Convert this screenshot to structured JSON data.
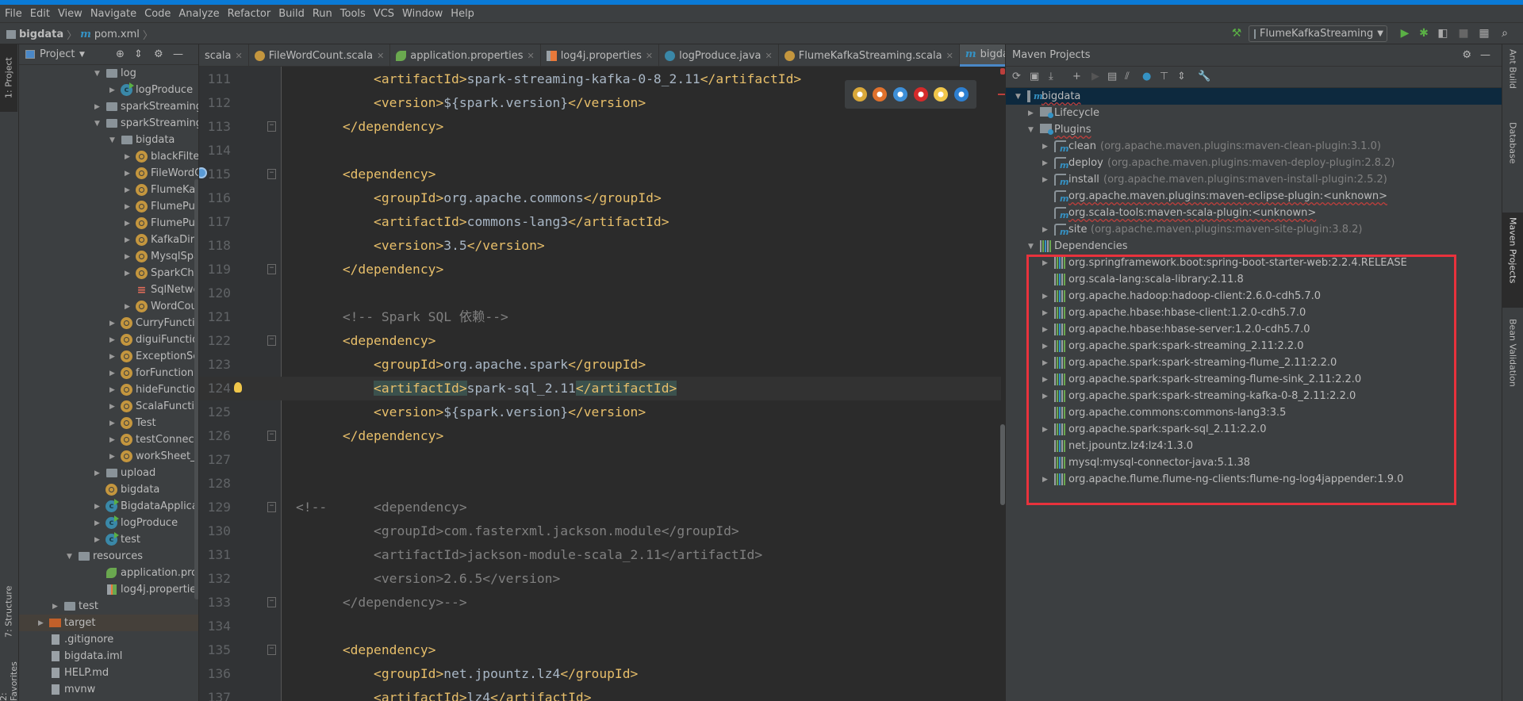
{
  "menu": [
    "File",
    "Edit",
    "View",
    "Navigate",
    "Code",
    "Analyze",
    "Refactor",
    "Build",
    "Run",
    "Tools",
    "VCS",
    "Window",
    "Help"
  ],
  "breadcrumb": {
    "project": "bigdata",
    "file": "pom.xml",
    "file_icon": "m"
  },
  "run_config": "FlumeKafkaStreaming",
  "left_strip": {
    "project": "1: Project",
    "structure": "7: Structure",
    "favorites": "2: Favorites"
  },
  "project_panel": {
    "title": "Project",
    "tree": [
      {
        "label": "log",
        "level": 3,
        "icon": "folder",
        "arrow": "open"
      },
      {
        "label": "logProduce",
        "level": 4,
        "icon": "cls",
        "arrow": "closed"
      },
      {
        "label": "sparkStreaming",
        "level": 3,
        "icon": "folder",
        "arrow": "closed"
      },
      {
        "label": "sparkStreamingSc",
        "level": 3,
        "icon": "folder",
        "arrow": "open"
      },
      {
        "label": "bigdata",
        "level": 4,
        "icon": "folder",
        "arrow": "open"
      },
      {
        "label": "blackFilter",
        "level": 5,
        "icon": "obj",
        "arrow": "closed"
      },
      {
        "label": "FileWordCo",
        "level": 5,
        "icon": "obj",
        "arrow": "closed"
      },
      {
        "label": "FlumeKafka",
        "level": 5,
        "icon": "obj",
        "arrow": "closed"
      },
      {
        "label": "FlumePullW",
        "level": 5,
        "icon": "obj",
        "arrow": "closed"
      },
      {
        "label": "FlumePushV",
        "level": 5,
        "icon": "obj",
        "arrow": "closed"
      },
      {
        "label": "KafkaDirect",
        "level": 5,
        "icon": "obj",
        "arrow": "closed"
      },
      {
        "label": "MysqlSpark",
        "level": 5,
        "icon": "obj",
        "arrow": "closed"
      },
      {
        "label": "SparkCheck",
        "level": 5,
        "icon": "obj",
        "arrow": "closed"
      },
      {
        "label": "SqlNetwork",
        "level": 5,
        "icon": "sql",
        "arrow": "none"
      },
      {
        "label": "WordCount",
        "level": 5,
        "icon": "obj",
        "arrow": "closed"
      },
      {
        "label": "CurryFunction",
        "level": 4,
        "icon": "obj",
        "arrow": "closed"
      },
      {
        "label": "diguiFunction",
        "level": 4,
        "icon": "obj",
        "arrow": "closed"
      },
      {
        "label": "ExceptionScala",
        "level": 4,
        "icon": "obj",
        "arrow": "closed"
      },
      {
        "label": "forFunction",
        "level": 4,
        "icon": "obj",
        "arrow": "closed"
      },
      {
        "label": "hideFunction",
        "level": 4,
        "icon": "obj",
        "arrow": "closed"
      },
      {
        "label": "ScalaFunction",
        "level": 4,
        "icon": "obj",
        "arrow": "closed"
      },
      {
        "label": "Test",
        "level": 4,
        "icon": "obj",
        "arrow": "closed"
      },
      {
        "label": "testConnectSql",
        "level": 4,
        "icon": "obj",
        "arrow": "closed"
      },
      {
        "label": "workSheet_che",
        "level": 4,
        "icon": "obj",
        "arrow": "closed"
      },
      {
        "label": "upload",
        "level": 3,
        "icon": "folder",
        "arrow": "closed"
      },
      {
        "label": "bigdata",
        "level": 3,
        "icon": "obj",
        "arrow": "none"
      },
      {
        "label": "BigdataApplicatio",
        "level": 3,
        "icon": "cls",
        "arrow": "closed"
      },
      {
        "label": "logProduce",
        "level": 3,
        "icon": "cls",
        "arrow": "closed"
      },
      {
        "label": "test",
        "level": 3,
        "icon": "cls",
        "arrow": "closed"
      },
      {
        "label": "resources",
        "level": 2,
        "icon": "folder",
        "arrow": "open"
      },
      {
        "label": "application.propertie",
        "level": 3,
        "icon": "spring",
        "arrow": "none"
      },
      {
        "label": "log4j.properties",
        "level": 3,
        "icon": "log4j",
        "arrow": "none"
      },
      {
        "label": "test",
        "level": 1,
        "icon": "folder",
        "arrow": "closed"
      },
      {
        "label": "target",
        "level": 0,
        "icon": "tfolder",
        "arrow": "closed",
        "highlight": true
      },
      {
        "label": ".gitignore",
        "level": 0,
        "icon": "file",
        "arrow": "none"
      },
      {
        "label": "bigdata.iml",
        "level": 0,
        "icon": "file",
        "arrow": "none"
      },
      {
        "label": "HELP.md",
        "level": 0,
        "icon": "file",
        "arrow": "none"
      },
      {
        "label": "mvnw",
        "level": 0,
        "icon": "file",
        "arrow": "none"
      }
    ]
  },
  "tabs": [
    {
      "label": "scala",
      "icon": "none"
    },
    {
      "label": "FileWordCount.scala",
      "icon": "scala"
    },
    {
      "label": "application.properties",
      "icon": "spring"
    },
    {
      "label": "log4j.properties",
      "icon": "log4j"
    },
    {
      "label": "logProduce.java",
      "icon": "java"
    },
    {
      "label": "FlumeKafkaStreaming.scala",
      "icon": "scala"
    },
    {
      "label": "bigdata",
      "icon": "maven",
      "active": true
    }
  ],
  "tab_overflow": "▾≡4",
  "editor": {
    "current_line": 124,
    "lines": [
      {
        "n": "111",
        "indent": 10,
        "seg": [
          [
            "tag",
            "<artifactId>"
          ],
          [
            "txt",
            "spark-streaming-kafka-0-8_2.11"
          ],
          [
            "tag",
            "</artifactId>"
          ]
        ]
      },
      {
        "n": "112",
        "indent": 10,
        "seg": [
          [
            "tag",
            "<version>"
          ],
          [
            "txt",
            "${spark.version}"
          ],
          [
            "tag",
            "</version>"
          ]
        ]
      },
      {
        "n": "113",
        "indent": 6,
        "fold": "end",
        "seg": [
          [
            "tag",
            "</dependency>"
          ]
        ]
      },
      {
        "n": "114",
        "indent": 0,
        "seg": []
      },
      {
        "n": "115",
        "indent": 6,
        "fold": "start",
        "mark": "override",
        "seg": [
          [
            "tag",
            "<dependency>"
          ]
        ]
      },
      {
        "n": "116",
        "indent": 10,
        "seg": [
          [
            "tag",
            "<groupId>"
          ],
          [
            "txt",
            "org.apache.commons"
          ],
          [
            "tag",
            "</groupId>"
          ]
        ]
      },
      {
        "n": "117",
        "indent": 10,
        "seg": [
          [
            "tag",
            "<artifactId>"
          ],
          [
            "txt",
            "commons-lang3"
          ],
          [
            "tag",
            "</artifactId>"
          ]
        ]
      },
      {
        "n": "118",
        "indent": 10,
        "seg": [
          [
            "tag",
            "<version>"
          ],
          [
            "txt",
            "3.5"
          ],
          [
            "tag",
            "</version>"
          ]
        ]
      },
      {
        "n": "119",
        "indent": 6,
        "fold": "end",
        "seg": [
          [
            "tag",
            "</dependency>"
          ]
        ]
      },
      {
        "n": "120",
        "indent": 0,
        "seg": []
      },
      {
        "n": "121",
        "indent": 6,
        "seg": [
          [
            "cm",
            "<!-- Spark SQL 依赖-->"
          ]
        ]
      },
      {
        "n": "122",
        "indent": 6,
        "fold": "start",
        "seg": [
          [
            "tag",
            "<dependency>"
          ]
        ]
      },
      {
        "n": "123",
        "indent": 10,
        "seg": [
          [
            "tag",
            "<groupId>"
          ],
          [
            "txt",
            "org.apache.spark"
          ],
          [
            "tag",
            "</groupId>"
          ]
        ]
      },
      {
        "n": "124",
        "indent": 10,
        "mark": "bulb",
        "seg": [
          [
            "tag match",
            "<artifactId>"
          ],
          [
            "txt",
            "spark-sql_2.11"
          ],
          [
            "tag match",
            "</artifactId>"
          ]
        ]
      },
      {
        "n": "125",
        "indent": 10,
        "seg": [
          [
            "tag",
            "<version>"
          ],
          [
            "txt",
            "${spark.version}"
          ],
          [
            "tag",
            "</version>"
          ]
        ]
      },
      {
        "n": "126",
        "indent": 6,
        "fold": "end",
        "seg": [
          [
            "tag",
            "</dependency>"
          ]
        ]
      },
      {
        "n": "127",
        "indent": 0,
        "seg": []
      },
      {
        "n": "128",
        "indent": 0,
        "seg": []
      },
      {
        "n": "129",
        "indent": 0,
        "fold": "start",
        "seg": [
          [
            "cm",
            "<!--      <dependency>"
          ]
        ]
      },
      {
        "n": "130",
        "indent": 10,
        "seg": [
          [
            "cm",
            "<groupId>com.fasterxml.jackson.module</groupId>"
          ]
        ]
      },
      {
        "n": "131",
        "indent": 10,
        "seg": [
          [
            "cm",
            "<artifactId>jackson-module-scala_2.11</artifactId>"
          ]
        ]
      },
      {
        "n": "132",
        "indent": 10,
        "seg": [
          [
            "cm",
            "<version>2.6.5</version>"
          ]
        ]
      },
      {
        "n": "133",
        "indent": 6,
        "fold": "end",
        "seg": [
          [
            "cm",
            "</dependency>-->"
          ]
        ]
      },
      {
        "n": "134",
        "indent": 0,
        "seg": []
      },
      {
        "n": "135",
        "indent": 6,
        "fold": "start",
        "seg": [
          [
            "tag",
            "<dependency>"
          ]
        ]
      },
      {
        "n": "136",
        "indent": 10,
        "seg": [
          [
            "tag",
            "<groupId>"
          ],
          [
            "txt",
            "net.jpountz.lz4"
          ],
          [
            "tag",
            "</groupId>"
          ]
        ]
      },
      {
        "n": "137",
        "indent": 10,
        "seg": [
          [
            "tag",
            "<artifactId>"
          ],
          [
            "txt",
            "lz4"
          ],
          [
            "tag",
            "</artifactId>"
          ]
        ]
      }
    ]
  },
  "browser_icons": [
    {
      "name": "chrome",
      "color": "#d9a83a"
    },
    {
      "name": "firefox",
      "color": "#e0712c"
    },
    {
      "name": "safari",
      "color": "#3d8fd8"
    },
    {
      "name": "opera",
      "color": "#d42a2a"
    },
    {
      "name": "ie",
      "color": "#f0c64a"
    },
    {
      "name": "edge",
      "color": "#2d7fd0"
    }
  ],
  "maven": {
    "title": "Maven Projects",
    "tree": [
      {
        "label": "bigdata",
        "level": 0,
        "icon": "module",
        "arrow": "open",
        "squig": true,
        "selected": true
      },
      {
        "label": "Lifecycle",
        "level": 1,
        "icon": "fgear",
        "arrow": "closed"
      },
      {
        "label": "Plugins",
        "level": 1,
        "icon": "fgear",
        "arrow": "open",
        "squig": true
      },
      {
        "label": "clean",
        "detail": "(org.apache.maven.plugins:maven-clean-plugin:3.1.0)",
        "level": 2,
        "icon": "plugin",
        "arrow": "closed"
      },
      {
        "label": "deploy",
        "detail": "(org.apache.maven.plugins:maven-deploy-plugin:2.8.2)",
        "level": 2,
        "icon": "plugin",
        "arrow": "closed"
      },
      {
        "label": "install",
        "detail": "(org.apache.maven.plugins:maven-install-plugin:2.5.2)",
        "level": 2,
        "icon": "plugin",
        "arrow": "closed"
      },
      {
        "label": "org.apache.maven.plugins:maven-eclipse-plugin:<unknown>",
        "level": 2,
        "icon": "plugin",
        "arrow": "none",
        "squig": true
      },
      {
        "label": "org.scala-tools:maven-scala-plugin:<unknown>",
        "level": 2,
        "icon": "plugin",
        "arrow": "none",
        "squig": true
      },
      {
        "label": "site",
        "detail": "(org.apache.maven.plugins:maven-site-plugin:3.8.2)",
        "level": 2,
        "icon": "plugin",
        "arrow": "closed"
      },
      {
        "label": "Dependencies",
        "level": 1,
        "icon": "bars",
        "arrow": "open"
      },
      {
        "label": "org.springframework.boot:spring-boot-starter-web:2.2.4.RELEASE",
        "level": 2,
        "icon": "bars",
        "arrow": "closed"
      },
      {
        "label": "org.scala-lang:scala-library:2.11.8",
        "level": 2,
        "icon": "bars",
        "arrow": "none"
      },
      {
        "label": "org.apache.hadoop:hadoop-client:2.6.0-cdh5.7.0",
        "level": 2,
        "icon": "bars",
        "arrow": "closed"
      },
      {
        "label": "org.apache.hbase:hbase-client:1.2.0-cdh5.7.0",
        "level": 2,
        "icon": "bars",
        "arrow": "closed"
      },
      {
        "label": "org.apache.hbase:hbase-server:1.2.0-cdh5.7.0",
        "level": 2,
        "icon": "bars",
        "arrow": "closed"
      },
      {
        "label": "org.apache.spark:spark-streaming_2.11:2.2.0",
        "level": 2,
        "icon": "bars",
        "arrow": "closed"
      },
      {
        "label": "org.apache.spark:spark-streaming-flume_2.11:2.2.0",
        "level": 2,
        "icon": "bars",
        "arrow": "closed"
      },
      {
        "label": "org.apache.spark:spark-streaming-flume-sink_2.11:2.2.0",
        "level": 2,
        "icon": "bars",
        "arrow": "closed"
      },
      {
        "label": "org.apache.spark:spark-streaming-kafka-0-8_2.11:2.2.0",
        "level": 2,
        "icon": "bars",
        "arrow": "closed"
      },
      {
        "label": "org.apache.commons:commons-lang3:3.5",
        "level": 2,
        "icon": "bars",
        "arrow": "none"
      },
      {
        "label": "org.apache.spark:spark-sql_2.11:2.2.0",
        "level": 2,
        "icon": "bars",
        "arrow": "closed"
      },
      {
        "label": "net.jpountz.lz4:lz4:1.3.0",
        "level": 2,
        "icon": "bars",
        "arrow": "none"
      },
      {
        "label": "mysql:mysql-connector-java:5.1.38",
        "level": 2,
        "icon": "bars",
        "arrow": "none"
      },
      {
        "label": "org.apache.flume.flume-ng-clients:flume-ng-log4jappender:1.9.0",
        "level": 2,
        "icon": "bars",
        "arrow": "closed"
      }
    ]
  },
  "right_strip": {
    "ant": "Ant Build",
    "database": "Database",
    "maven": "Maven Projects",
    "bean": "Bean Validation"
  },
  "colors": {
    "accent": "#4a88c7",
    "highlight_box": "#e8323c",
    "tag": "#e8bf6a"
  }
}
